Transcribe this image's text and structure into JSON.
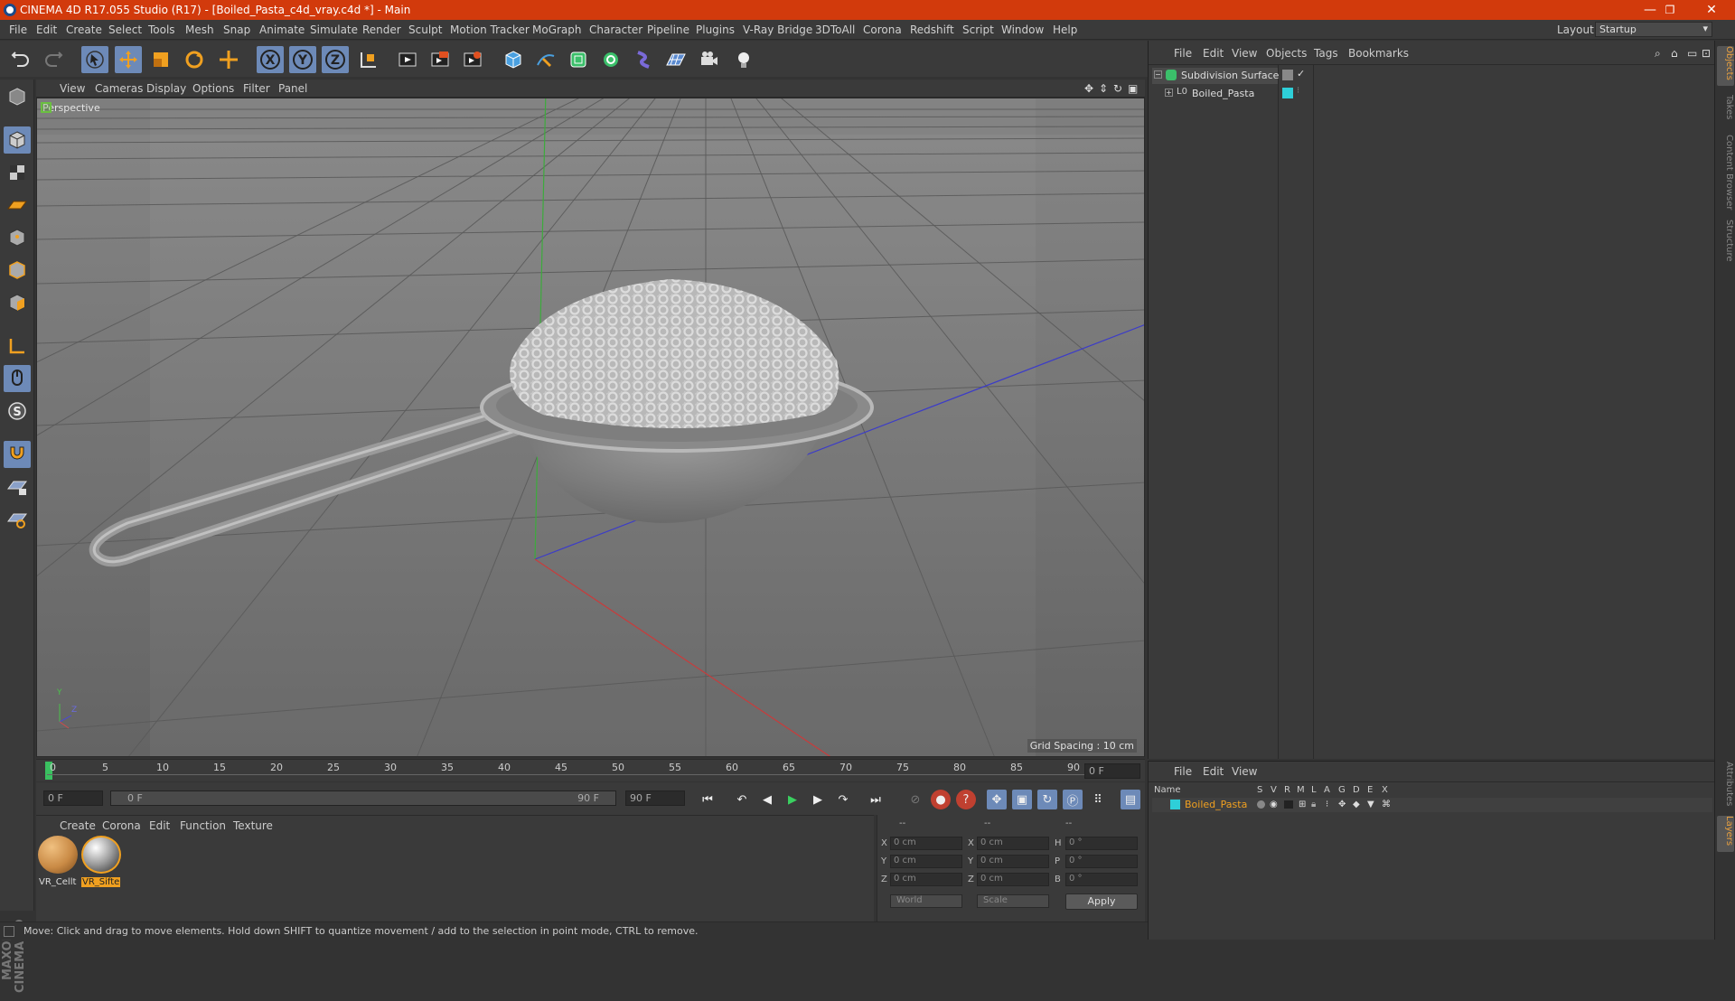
{
  "window": {
    "title": "CINEMA 4D R17.055 Studio (R17) - [Boiled_Pasta_c4d_vray.c4d *] - Main",
    "minimize": "—",
    "restore": "❐",
    "close": "✕"
  },
  "menu": {
    "items": [
      "File",
      "Edit",
      "Create",
      "Select",
      "Tools",
      "Mesh",
      "Snap",
      "Animate",
      "Simulate",
      "Render",
      "Sculpt",
      "Motion Tracker",
      "MoGraph",
      "Character",
      "Pipeline",
      "Plugins",
      "V-Ray Bridge",
      "3DToAll",
      "Corona",
      "Redshift",
      "Script",
      "Window",
      "Help"
    ],
    "layout_label": "Layout:",
    "layout_value": "Startup"
  },
  "viewport": {
    "menu": [
      "View",
      "Cameras",
      "Display",
      "Options",
      "Filter",
      "Panel"
    ],
    "label": "Perspective",
    "grid_spacing": "Grid Spacing : 10 cm",
    "axis_y": "Y",
    "axis_z": "Z"
  },
  "timeline": {
    "ticks": [
      "0",
      "5",
      "10",
      "15",
      "20",
      "25",
      "30",
      "35",
      "40",
      "45",
      "50",
      "55",
      "60",
      "65",
      "70",
      "75",
      "80",
      "85",
      "90"
    ],
    "current_frame": "0 F",
    "start": "0 F",
    "range_start": "0 F",
    "range_end": "90 F",
    "end": "90 F"
  },
  "materials": {
    "menu": [
      "Create",
      "Corona",
      "Edit",
      "Function",
      "Texture"
    ],
    "items": [
      {
        "name": "VR_Cellt",
        "color": "#c98a45"
      },
      {
        "name": "VR_Sifte",
        "color": "#9a9a9a"
      }
    ]
  },
  "coordinates": {
    "headers": [
      "--",
      "--",
      "--"
    ],
    "rows": [
      {
        "a": "X",
        "av": "0 cm",
        "b": "X",
        "bv": "0 cm",
        "c": "H",
        "cv": "0 °"
      },
      {
        "a": "Y",
        "av": "0 cm",
        "b": "Y",
        "bv": "0 cm",
        "c": "P",
        "cv": "0 °"
      },
      {
        "a": "Z",
        "av": "0 cm",
        "b": "Z",
        "bv": "0 cm",
        "c": "B",
        "cv": "0 °"
      }
    ],
    "space": "World",
    "mode": "Scale",
    "apply": "Apply"
  },
  "status": "Move: Click and drag to move elements. Hold down SHIFT to quantize movement / add to the selection in point mode, CTRL to remove.",
  "object_manager": {
    "menu": [
      "File",
      "Edit",
      "View",
      "Objects",
      "Tags",
      "Bookmarks"
    ],
    "objects": [
      {
        "name": "Subdivision Surface"
      },
      {
        "name": "Boiled_Pasta"
      }
    ]
  },
  "layer_manager": {
    "menu": [
      "File",
      "Edit",
      "View"
    ],
    "columns": [
      "Name",
      "S",
      "V",
      "R",
      "M",
      "L",
      "A",
      "G",
      "D",
      "E",
      "X"
    ],
    "layer_name": "Boiled_Pasta",
    "layer_color": "#2ecfd8"
  },
  "side_tabs": {
    "top": [
      "Objects",
      "Takes",
      "Content Browser",
      "Structure"
    ],
    "bottom": [
      "Attributes",
      "Layers"
    ]
  },
  "brand": "MAXON CINEMA 4D",
  "colors": {
    "title_bar": "#d23a0c",
    "accent_blue": "#6d8ab8",
    "selection_orange": "#f0a020"
  }
}
